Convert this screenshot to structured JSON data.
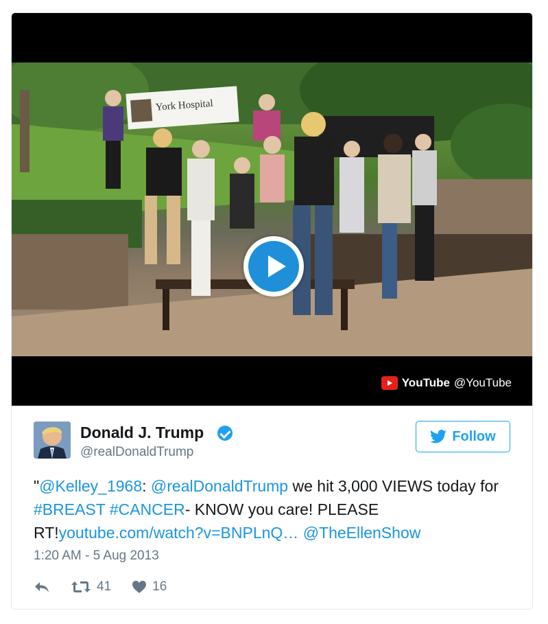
{
  "video": {
    "banner_text": "York Hospital",
    "source_brand": "YouTube",
    "source_handle": "@YouTube"
  },
  "tweet": {
    "name": "Donald J. Trump",
    "handle": "@realDonaldTrump",
    "follow_label": "Follow",
    "text_parts": {
      "quote_open": "\"",
      "mention1": "@Kelley_1968",
      "colon": ": ",
      "mention2": "@realDonaldTrump",
      "plain1": " we hit 3,000 VIEWS today for ",
      "hashtag1": "#BREAST",
      "space": " ",
      "hashtag2": "#CANCER",
      "plain2": "- KNOW you care! PLEASE RT!",
      "url": "youtube.com/watch?v=BNPLnQ…",
      "mention3": "@TheEllenShow"
    },
    "timestamp": "1:20 AM - 5 Aug 2013",
    "retweets": "41",
    "likes": "16"
  },
  "colors": {
    "accent": "#1da1f2",
    "link": "#1b95e0",
    "muted": "#657786",
    "youtube_red": "#e62117"
  },
  "icons": {
    "play": "play-icon",
    "verified": "verified-badge-icon",
    "follow": "twitter-bird-icon",
    "reply": "reply-icon",
    "retweet": "retweet-icon",
    "like": "heart-icon",
    "youtube": "youtube-logo-icon"
  }
}
